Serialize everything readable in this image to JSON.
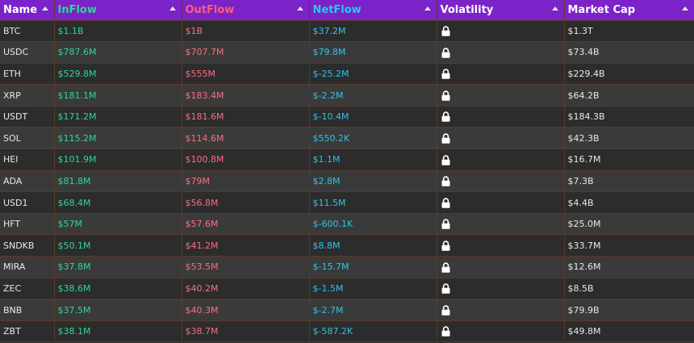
{
  "headers": {
    "name": "Name",
    "inflow": "InFlow",
    "outflow": "OutFlow",
    "netflow": "NetFlow",
    "volatility": "Volatility",
    "market_cap": "Market Cap"
  },
  "colors": {
    "header_bg": "#7b22c8",
    "inflow": "#2fd69a",
    "outflow": "#ff6b81",
    "netflow": "#2ec4e8"
  },
  "icons": {
    "volatility": "lock-icon",
    "sort": "sort-asc-icon"
  },
  "rows": [
    {
      "name": "BTC",
      "inflow": "$1.1B",
      "outflow": "$1B",
      "netflow": "$37.2M",
      "market_cap": "$1.3T"
    },
    {
      "name": "USDC",
      "inflow": "$787.6M",
      "outflow": "$707.7M",
      "netflow": "$79.8M",
      "market_cap": "$73.4B"
    },
    {
      "name": "ETH",
      "inflow": "$529.8M",
      "outflow": "$555M",
      "netflow": "$-25.2M",
      "market_cap": "$229.4B"
    },
    {
      "name": "XRP",
      "inflow": "$181.1M",
      "outflow": "$183.4M",
      "netflow": "$-2.2M",
      "market_cap": "$64.2B"
    },
    {
      "name": "USDT",
      "inflow": "$171.2M",
      "outflow": "$181.6M",
      "netflow": "$-10.4M",
      "market_cap": "$184.3B"
    },
    {
      "name": "SOL",
      "inflow": "$115.2M",
      "outflow": "$114.6M",
      "netflow": "$550.2K",
      "market_cap": "$42.3B"
    },
    {
      "name": "HEI",
      "inflow": "$101.9M",
      "outflow": "$100.8M",
      "netflow": "$1.1M",
      "market_cap": "$16.7M"
    },
    {
      "name": "ADA",
      "inflow": "$81.8M",
      "outflow": "$79M",
      "netflow": "$2.8M",
      "market_cap": "$7.3B"
    },
    {
      "name": "USD1",
      "inflow": "$68.4M",
      "outflow": "$56.8M",
      "netflow": "$11.5M",
      "market_cap": "$4.4B"
    },
    {
      "name": "HFT",
      "inflow": "$57M",
      "outflow": "$57.6M",
      "netflow": "$-600.1K",
      "market_cap": "$25.0M"
    },
    {
      "name": "SNDKB",
      "inflow": "$50.1M",
      "outflow": "$41.2M",
      "netflow": "$8.8M",
      "market_cap": "$33.7M"
    },
    {
      "name": "MIRA",
      "inflow": "$37.8M",
      "outflow": "$53.5M",
      "netflow": "$-15.7M",
      "market_cap": "$12.6M"
    },
    {
      "name": "ZEC",
      "inflow": "$38.6M",
      "outflow": "$40.2M",
      "netflow": "$-1.5M",
      "market_cap": "$8.5B"
    },
    {
      "name": "BNB",
      "inflow": "$37.5M",
      "outflow": "$40.3M",
      "netflow": "$-2.7M",
      "market_cap": "$79.9B"
    },
    {
      "name": "ZBT",
      "inflow": "$38.1M",
      "outflow": "$38.7M",
      "netflow": "$-587.2K",
      "market_cap": "$49.8M"
    }
  ]
}
